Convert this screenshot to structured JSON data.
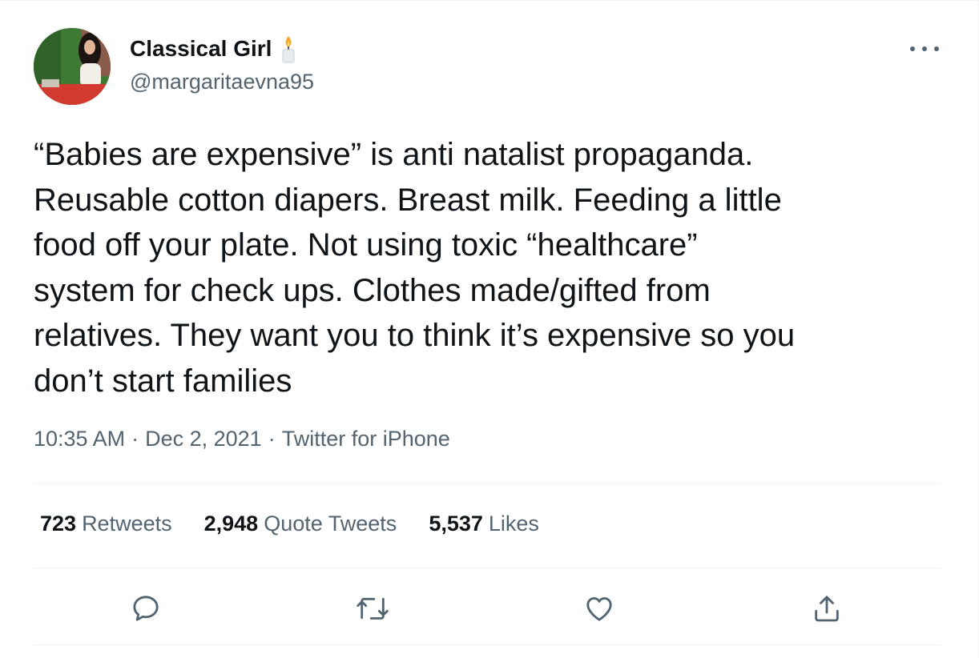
{
  "user": {
    "display_name": "Classical Girl",
    "handle": "@margaritaevna95"
  },
  "tweet": {
    "text": "“Babies are expensive” is anti natalist propaganda.\nReusable cotton diapers. Breast milk. Feeding a little\nfood off your plate. Not using toxic “healthcare”\nsystem for check ups. Clothes made/gifted from\nrelatives. They want you to think it’s expensive so you\ndon’t start families",
    "time": "10:35 AM",
    "date": "Dec 2, 2021",
    "source": "Twitter for iPhone",
    "separator": "·"
  },
  "stats": {
    "retweets_count": "723",
    "retweets_label": "Retweets",
    "quotes_count": "2,948",
    "quotes_label": "Quote Tweets",
    "likes_count": "5,537",
    "likes_label": "Likes"
  },
  "icons": {
    "name_emoji": "candle-icon",
    "more": "more-icon",
    "reply": "reply-icon",
    "retweet": "retweet-icon",
    "like": "heart-icon",
    "share": "share-icon"
  },
  "colors": {
    "text": "#0f1419",
    "secondary": "#536471",
    "divider": "#eff3f4"
  }
}
